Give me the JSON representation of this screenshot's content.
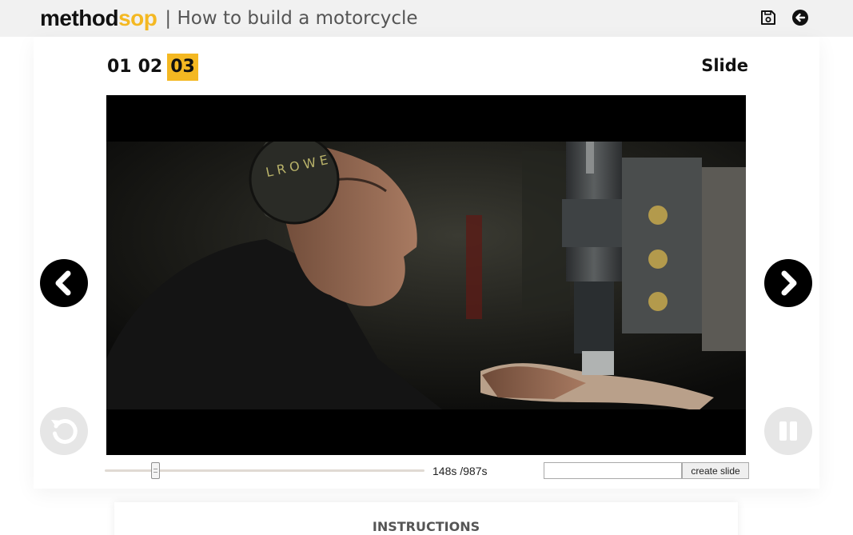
{
  "header": {
    "logo_part1": "method",
    "logo_part2": "sop",
    "title": "| How to build a motorcycle",
    "icons": [
      "save-icon",
      "back-arrow-icon"
    ]
  },
  "steps": [
    {
      "label": "01",
      "active": false
    },
    {
      "label": "02",
      "active": false
    },
    {
      "label": "03",
      "active": true
    }
  ],
  "slide_label": "Slide",
  "video": {
    "frame": "close-up of a man wearing ear protection operating a drill press in a dark workshop",
    "controls": [
      "prev-icon",
      "next-icon",
      "replay-icon",
      "pause-icon"
    ]
  },
  "timeline": {
    "current_seconds": 148,
    "total_seconds": 987,
    "readout": "148s /987s"
  },
  "create_slide": {
    "input_value": "",
    "button_label": "create slide"
  },
  "instructions": {
    "title": "INSTRUCTIONS"
  },
  "colors": {
    "accent": "#f4b822",
    "header_bg": "#f1f1f1",
    "text_dark": "#111111",
    "muted_button": "#e6e6e6"
  }
}
